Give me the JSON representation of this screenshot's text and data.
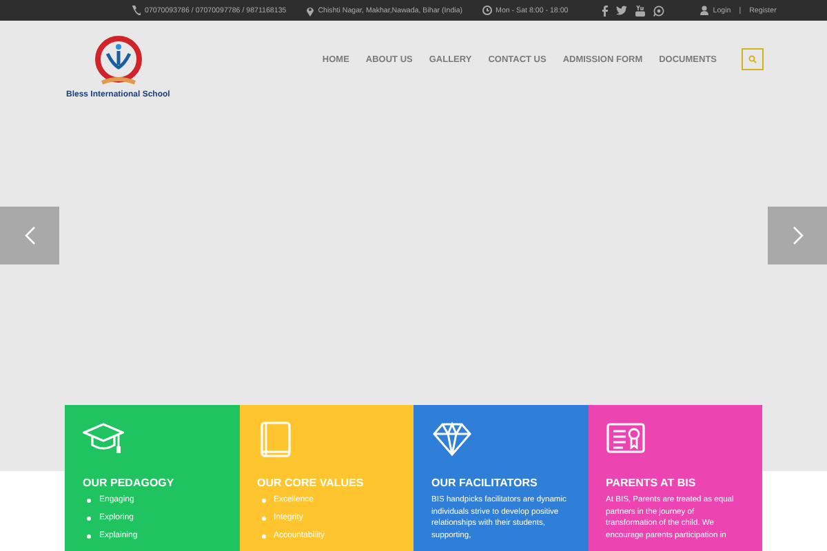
{
  "top_bar": {
    "phone": "07070093786 / 07070097786 / 9871168135",
    "address": "Chishti Nagar, Makhar,Nawada, Bihar (India)",
    "hours": "Mon - Sat 8:00 - 18:00",
    "login": "Login",
    "separator": "|",
    "register": "Register"
  },
  "logo": {
    "name": "Bless International School"
  },
  "nav": [
    {
      "label": "HOME",
      "selected": false
    },
    {
      "label": "ABOUT US",
      "selected": false
    },
    {
      "label": "GALLERY",
      "selected": false
    },
    {
      "label": "CONTACT US",
      "selected": false
    },
    {
      "label": "ADMISSION FORM",
      "selected": false
    },
    {
      "label": "DOCUMENTS",
      "selected": false
    }
  ],
  "cards": [
    {
      "kind": "list",
      "color": "#1fc35f",
      "title": "OUR PEDAGOGY",
      "items": [
        "Engaging",
        "Exploring",
        "Explaining"
      ]
    },
    {
      "kind": "list",
      "color": "#fec52e",
      "title": "OUR CORE VALUES",
      "items": [
        "Excellence",
        "Integrity",
        "Accountability"
      ]
    },
    {
      "kind": "text",
      "color": "#2f7fd8",
      "title": "OUR FACILITATORS",
      "text": "BIS handpicks facilitators are dynamic individuals strive to develop positive relationships with their students, supporting,"
    },
    {
      "kind": "text",
      "color": "#ec45b2",
      "title": "PARENTS AT BIS",
      "text": "At BIS, Parents are treated as equal partners in the journey of transformation of the child. We encourage parents participation in"
    }
  ]
}
